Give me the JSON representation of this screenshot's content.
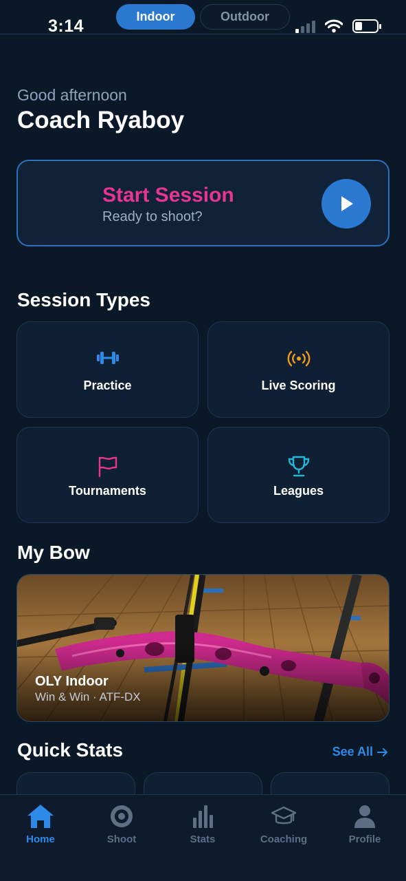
{
  "status_bar": {
    "time": "3:14",
    "segments": [
      {
        "label": "Indoor",
        "active": true
      },
      {
        "label": "Outdoor",
        "active": false
      }
    ]
  },
  "greeting": {
    "salutation": "Good afternoon",
    "name": "Coach Ryaboy"
  },
  "start_session": {
    "title": "Start Session",
    "subtitle": "Ready to shoot?",
    "icon": "play-icon"
  },
  "session_types": {
    "title": "Session Types",
    "items": [
      {
        "label": "Practice",
        "icon": "dumbbell-icon",
        "color": "#2e8ae8"
      },
      {
        "label": "Live Scoring",
        "icon": "broadcast-icon",
        "color": "#f29a1a"
      },
      {
        "label": "Tournaments",
        "icon": "flag-icon",
        "color": "#e8358f"
      },
      {
        "label": "Leagues",
        "icon": "trophy-icon",
        "color": "#27b6d6"
      }
    ]
  },
  "my_bow": {
    "title": "My Bow",
    "name": "OLY Indoor",
    "details": "Win & Win · ATF-DX"
  },
  "quick_stats": {
    "title": "Quick Stats",
    "see_all": "See All"
  },
  "tab_bar": {
    "items": [
      {
        "label": "Home",
        "icon": "home-icon",
        "active": true
      },
      {
        "label": "Shoot",
        "icon": "target-icon",
        "active": false
      },
      {
        "label": "Stats",
        "icon": "bar-chart-icon",
        "active": false
      },
      {
        "label": "Coaching",
        "icon": "graduation-cap-icon",
        "active": false
      },
      {
        "label": "Profile",
        "icon": "person-icon",
        "active": false
      }
    ]
  },
  "colors": {
    "background": "#0b1828",
    "accent": "#2a78d0",
    "pink": "#e8358f"
  }
}
